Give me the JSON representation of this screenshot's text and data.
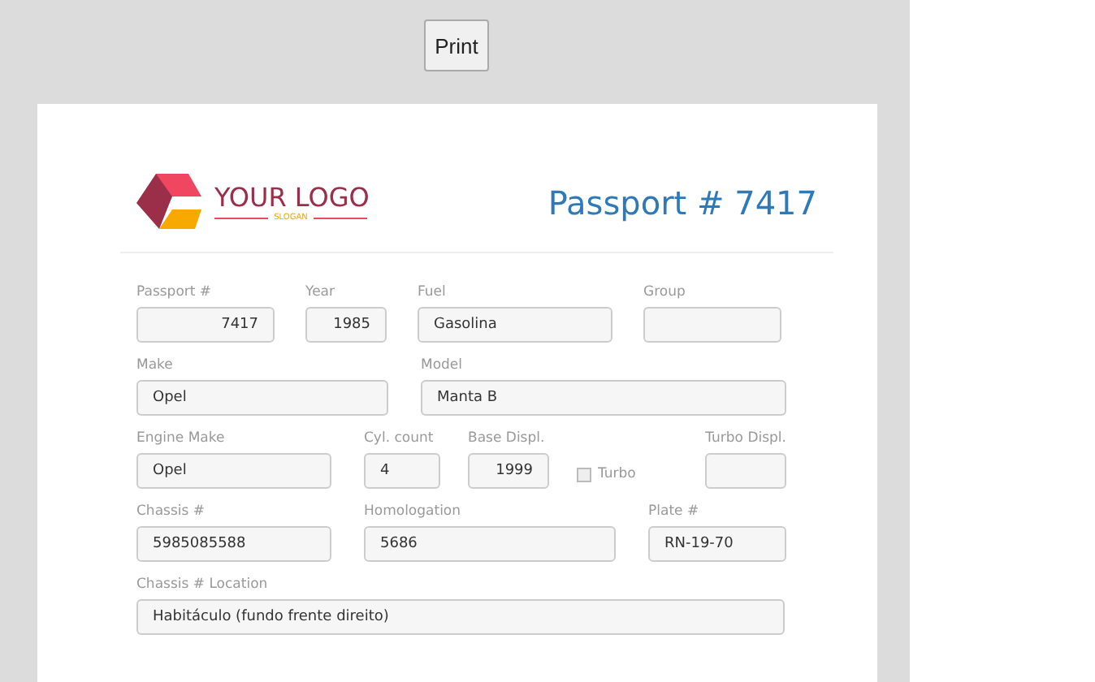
{
  "print_button": "Print",
  "logo": {
    "name": "YOUR LOGO",
    "slogan": "SLOGAN"
  },
  "title": "Passport # 7417",
  "rows": [
    [
      {
        "kind": "number",
        "label": "Passport #",
        "value": "7417"
      },
      {
        "kind": "number",
        "label": "Year",
        "value": "1985"
      },
      {
        "kind": "text",
        "label": "Fuel",
        "value": "Gasolina"
      },
      {
        "kind": "text",
        "label": "Group"
      }
    ],
    [
      {
        "kind": "text",
        "label": "Make",
        "value": "Opel"
      },
      {
        "kind": "text",
        "label": "Model",
        "value": "Manta B"
      }
    ],
    [
      {
        "kind": "text",
        "label": "Engine Make",
        "value": "Opel"
      },
      {
        "kind": "text",
        "label": "Cyl. count",
        "value": "4"
      },
      {
        "kind": "number",
        "label": "Base Displ.",
        "value": "1999"
      },
      {
        "kind": "checkbox",
        "label": "Turbo",
        "checked": false
      },
      {
        "kind": "text",
        "label": "Turbo Displ."
      }
    ],
    [
      {
        "kind": "text",
        "label": "Chassis #",
        "value": "5985085588"
      },
      {
        "kind": "text",
        "label": "Homologation",
        "value": "5686"
      },
      {
        "kind": "text",
        "label": "Plate #",
        "value": "RN-19-70"
      }
    ],
    [
      {
        "kind": "text",
        "label": "Chassis # Location",
        "value": "Habitáculo (fundo frente direito)"
      }
    ]
  ]
}
